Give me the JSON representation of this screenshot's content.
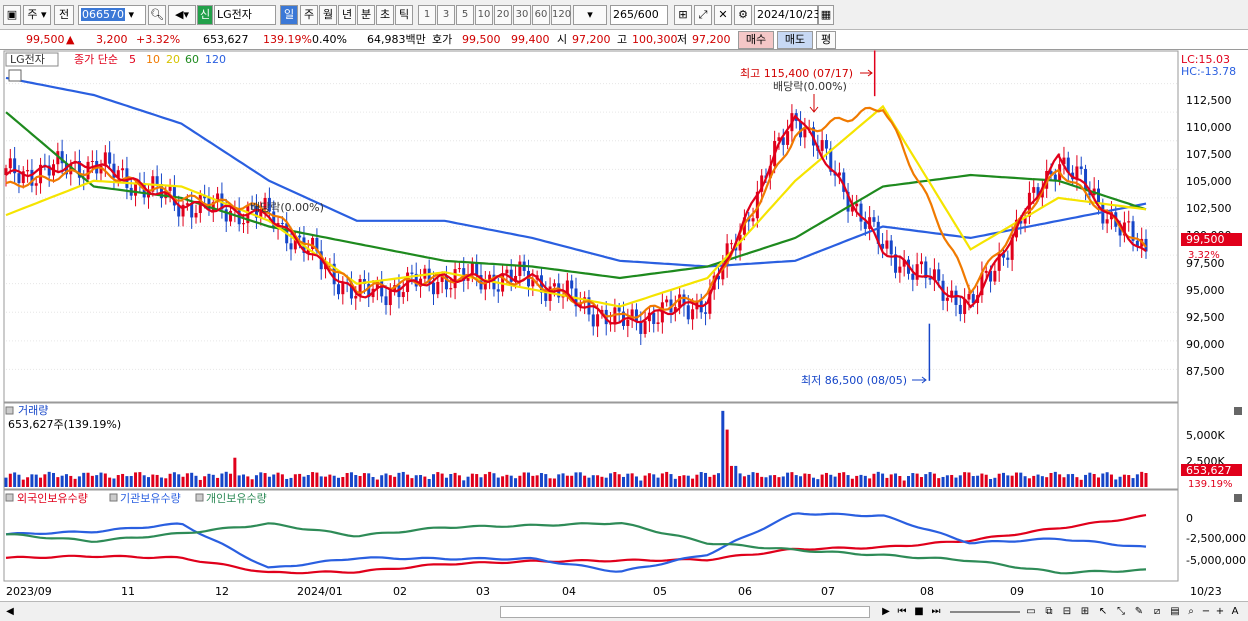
{
  "toolbar": {
    "period_type": "주",
    "prev_label": "전",
    "stock_code": "066570",
    "new_badge": "신",
    "stock_name": "LG전자",
    "periods": [
      "일",
      "주",
      "월",
      "년",
      "분",
      "초",
      "틱"
    ],
    "active_period": "일",
    "intervals": [
      "1",
      "3",
      "5",
      "10",
      "20",
      "30",
      "60",
      "120"
    ],
    "count": "265",
    "count_max": "/600",
    "date": "2024/10/23"
  },
  "quote": {
    "price": "99,500",
    "arrow": "▲",
    "change": "3,200",
    "change_pct": "+3.32%",
    "volume": "653,627",
    "volume_ratio": "139.19%",
    "turnover_pct": "0.40%",
    "amount": "64,983백만",
    "ask_label": "호가",
    "ask": "99,500",
    "bid": "99,400",
    "open_label": "시",
    "open": "97,200",
    "high_label": "고",
    "high": "100,300",
    "low_label": "저",
    "low": "97,200",
    "buy_label": "매수",
    "sell_label": "매도",
    "eval_label": "평"
  },
  "price_panel": {
    "stock": "LG전자",
    "ma_title": "종가 단순",
    "ma_periods": [
      "5",
      "10",
      "20",
      "60",
      "120"
    ],
    "lc": "LC:15.03",
    "hc": "HC:-13.78",
    "high_annotation": "최고 115,400 (07/17)",
    "low_annotation": "최저 86,500 (08/05)",
    "dividend_label_1": "배당락(0.00%)",
    "dividend_label_2": "배당락(0.00%)",
    "y_ticks": [
      "112,500",
      "110,000",
      "107,500",
      "105,000",
      "102,500",
      "100,000",
      "97,500",
      "95,000",
      "92,500",
      "90,000",
      "87,500"
    ],
    "current_price": "99,500",
    "current_pct": "3.32%"
  },
  "volume_panel": {
    "title": "거래량",
    "value": "653,627주(139.19%)",
    "y_ticks": [
      "5,000K",
      "2,500K"
    ],
    "current": "653,627",
    "current_pct": "139.19%"
  },
  "holding_panel": {
    "series": [
      "외국인보유수량",
      "기관보유수량",
      "개인보유수량"
    ],
    "y_ticks": [
      "0",
      "-2,500,000",
      "-5,000,000"
    ]
  },
  "x_axis": [
    "2023/09",
    "11",
    "12",
    "2024/01",
    "02",
    "03",
    "04",
    "05",
    "06",
    "07",
    "08",
    "09",
    "10"
  ],
  "x_end": "10/23",
  "colors": {
    "ma5": "#e0001b",
    "ma10": "#f07a00",
    "ma20": "#f5e400",
    "ma60": "#1e8a1e",
    "ma120": "#2a5fe0",
    "candle_up": "#e0001b",
    "candle_down": "#1646c8",
    "foreign": "#e0001b",
    "institution": "#2a5fe0",
    "individual": "#2e8b57"
  },
  "chart_data": {
    "type": "line",
    "ticker": "066570",
    "name": "LG전자",
    "x": [
      "2023/09",
      "11",
      "12",
      "2024/01",
      "02",
      "03",
      "04",
      "05",
      "06",
      "07",
      "08",
      "09",
      "10"
    ],
    "series": [
      {
        "name": "5",
        "values": [
          104500,
          105500,
          102000,
          101000,
          94000,
          95500,
          95500,
          91500,
          93500,
          110000,
          98000,
          93000,
          106000,
          97500
        ]
      },
      {
        "name": "10",
        "values": [
          103500,
          105000,
          102500,
          101500,
          94500,
          95500,
          95200,
          92000,
          94000,
          108000,
          110500,
          94500,
          105000,
          98000
        ]
      },
      {
        "name": "20",
        "values": [
          101000,
          104000,
          103500,
          100500,
          95000,
          96000,
          94500,
          93000,
          95500,
          104000,
          110500,
          98000,
          102500,
          101500
        ]
      },
      {
        "name": "60",
        "values": [
          110000,
          103500,
          102500,
          100000,
          98500,
          97000,
          96500,
          95500,
          96500,
          99000,
          103500,
          104500,
          104000,
          101500
        ]
      },
      {
        "name": "120",
        "values": [
          113000,
          111500,
          109000,
          104000,
          100500,
          100500,
          99000,
          97000,
          96500,
          97000,
          100000,
          99000,
          100500,
          102000
        ]
      }
    ],
    "high": {
      "value": 115400,
      "date": "07/17"
    },
    "low": {
      "value": 86500,
      "date": "08/05"
    },
    "last": 99500,
    "ylim": [
      85000,
      115000
    ],
    "volume_ylim": [
      0,
      7000000
    ],
    "holding_ylim": [
      -6500000,
      1500000
    ]
  }
}
